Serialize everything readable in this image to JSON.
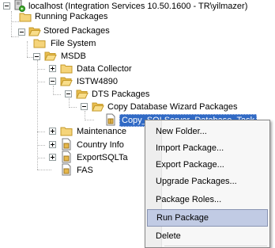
{
  "tree": {
    "root": "localhost (Integration Services 10.50.1600 - TR\\yilmazer)",
    "running_packages": "Running Packages",
    "stored_packages": "Stored Packages",
    "file_system": "File System",
    "msdb": "MSDB",
    "data_collector": "Data Collector",
    "istw4890": "ISTW4890",
    "dts_packages": "DTS Packages",
    "copy_wizard": "Copy Database Wizard Packages",
    "selected_package": "Copy_SQLServer_Database_Task",
    "maintenance": "Maintenance",
    "country_info": "Country Info",
    "export_sql": "ExportSQLTa",
    "fas": "FAS"
  },
  "context_menu": {
    "items": [
      "New Folder...",
      "Import Package...",
      "Export Package...",
      "Upgrade Packages...",
      "Package Roles...",
      "Run Package",
      "Delete"
    ],
    "hovered": "Run Package"
  },
  "colors": {
    "folder": "#f5d47a",
    "selection": "#316ac5",
    "menu_hover": "#c1cbe4"
  }
}
